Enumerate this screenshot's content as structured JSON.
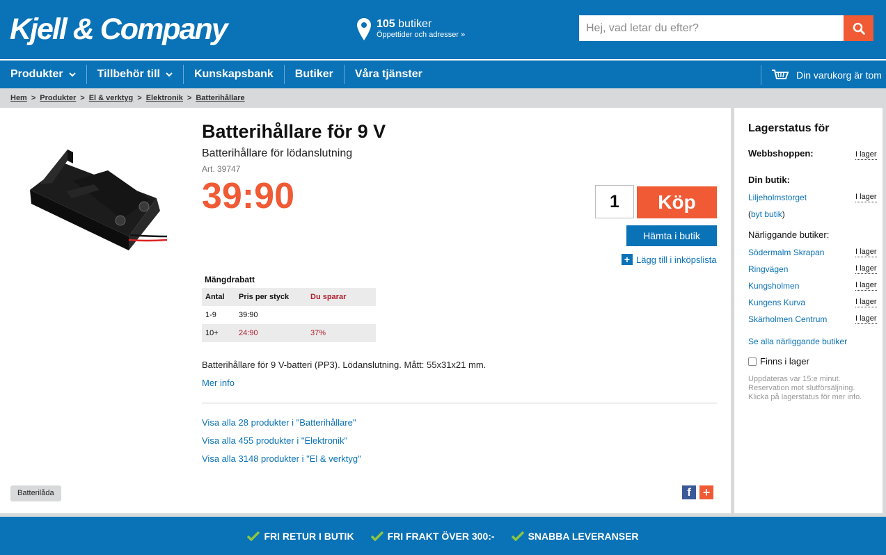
{
  "header": {
    "logo_text": "Kjell & Company",
    "stores_count": "105",
    "stores_label": "butiker",
    "stores_sub": "Öppettider och adresser »",
    "search_placeholder": "Hej, vad letar du efter?"
  },
  "nav": {
    "items": [
      "Produkter",
      "Tillbehör till",
      "Kunskapsbank",
      "Butiker",
      "Våra tjänster"
    ],
    "cart_label": "Din varukorg är tom"
  },
  "breadcrumb": [
    "Hem",
    "Produkter",
    "El & verktyg",
    "Elektronik",
    "Batterihållare"
  ],
  "product": {
    "title": "Batterihållare för 9 V",
    "subtitle": "Batterihållare för lödanslutning",
    "art_nr": "Art. 39747",
    "price": "39:90",
    "quantity": "1",
    "buy_label": "Köp",
    "pickup_label": "Hämta i butik",
    "add_list_label": "Lägg till i inköpslista",
    "description": "Batterihållare för 9 V-batteri (PP3). Lödanslutning. Mått: 55x31x21 mm.",
    "more_info": "Mer info",
    "tag": "Batterilåda"
  },
  "bulk_discount": {
    "caption": "Mängdrabatt",
    "headers": [
      "Antal",
      "Pris per styck",
      "Du sparar"
    ],
    "rows": [
      [
        "1-9",
        "39:90",
        ""
      ],
      [
        "10+",
        "24:90",
        "37%"
      ]
    ]
  },
  "category_links": [
    "Visa alla 28 produkter i \"Batterihållare\"",
    "Visa alla 455 produkter i \"Elektronik\"",
    "Visa alla 3148 produkter i \"El & verktyg\""
  ],
  "sidebar": {
    "heading": "Lagerstatus för",
    "webshop_label": "Webbshoppen:",
    "webshop_status": "I lager",
    "your_store_label": "Din butik:",
    "your_store": "Liljeholmstorget",
    "your_store_status": "I lager",
    "change_store_open": "(",
    "change_store": "byt butik",
    "change_store_close": ")",
    "nearby_label": "Närliggande butiker:",
    "nearby": [
      {
        "name": "Södermalm Skrapan",
        "status": "I lager"
      },
      {
        "name": "Ringvägen",
        "status": "I lager"
      },
      {
        "name": "Kungsholmen",
        "status": "I lager"
      },
      {
        "name": "Kungens Kurva",
        "status": "I lager"
      },
      {
        "name": "Skärholmen Centrum",
        "status": "I lager"
      }
    ],
    "see_all": "Se alla närliggande butiker",
    "in_stock_filter": "Finns i lager",
    "note_lines": [
      "Uppdateras var 15:e minut.",
      "Reservation mot slutförsäljning.",
      "Klicka på lagerstatus för mer info."
    ]
  },
  "footer": {
    "usps": [
      "FRI RETUR I BUTIK",
      "FRI FRAKT ÖVER 300:-",
      "SNABBA LEVERANSER"
    ]
  },
  "colors": {
    "brand_blue": "#0a72b6",
    "price_orange": "#f05a35",
    "discount_red": "#b01e2d",
    "check_green": "#8cc63f"
  }
}
